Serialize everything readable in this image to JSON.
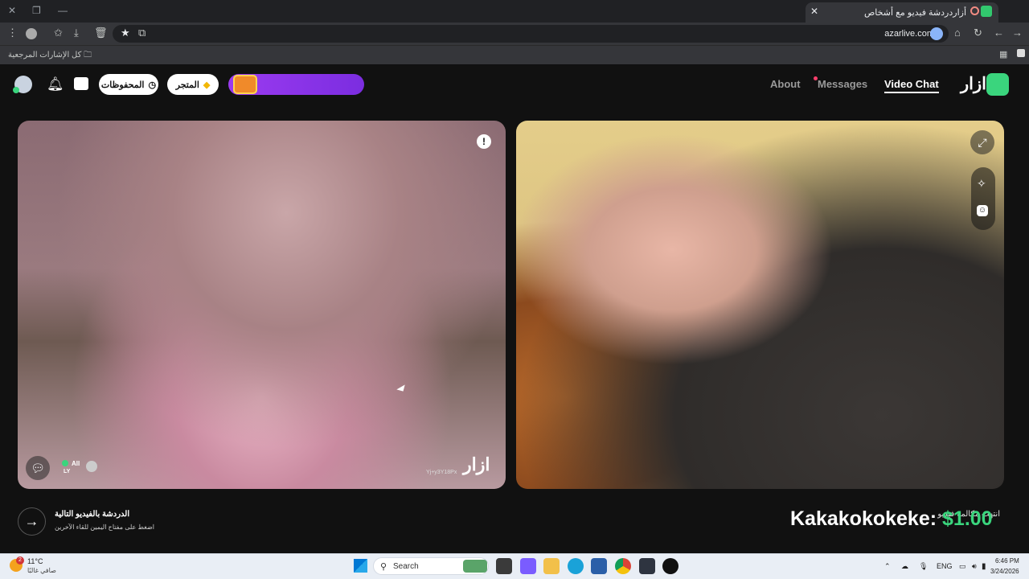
{
  "browser": {
    "tab_title": "أزاردردشة فيديو مع أشخاص",
    "url": "azarlive.com",
    "bookmarks_label": "كل الإشارات المرجعية"
  },
  "app": {
    "logo_text": "ازار",
    "nav": [
      {
        "label": "Video Chat",
        "active": true
      },
      {
        "label": "Messages",
        "has_dot": true
      },
      {
        "label": "About"
      }
    ],
    "store_label": "المتجر",
    "saved_label": "المحفوظات"
  },
  "video_left": {
    "watermark": "ازار",
    "watermark_id": "Yj+y3Y18Px",
    "filter_label": "All",
    "country_code": "LY"
  },
  "next": {
    "title": "الدردشة بالفيديو التالية",
    "subtitle": "اضغط على مفتاح اليمين للقاء الآخرين"
  },
  "overlay": {
    "name": "Kakakokokeke:",
    "amount": "$1.00",
    "partial_text": "انتهت مكالمة فيديو"
  },
  "taskbar": {
    "weather_temp": "11°C",
    "weather_desc": "صافي غالبًا",
    "search_placeholder": "Search",
    "language": "ENG",
    "time": "6:46 PM",
    "date": "3/24/2026",
    "notification_count": "2"
  }
}
